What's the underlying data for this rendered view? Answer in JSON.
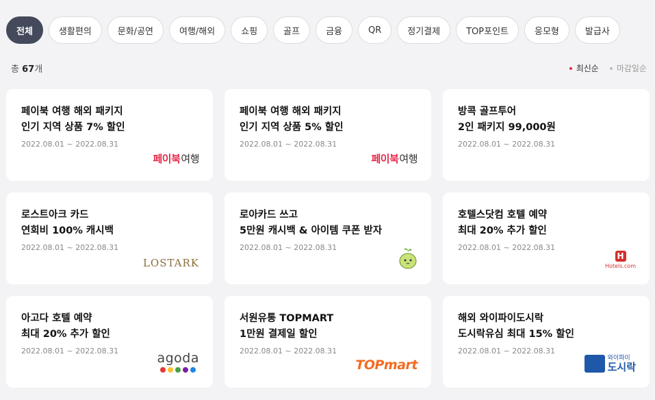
{
  "tabs": [
    {
      "label": "전체",
      "active": true
    },
    {
      "label": "생활편의"
    },
    {
      "label": "문화/공연"
    },
    {
      "label": "여행/해외"
    },
    {
      "label": "쇼핑"
    },
    {
      "label": "골프"
    },
    {
      "label": "금융"
    },
    {
      "label": "QR"
    },
    {
      "label": "정기결제"
    },
    {
      "label": "TOP포인트"
    },
    {
      "label": "응모형"
    },
    {
      "label": "발급사"
    }
  ],
  "summary": {
    "prefix": "총 ",
    "count": "67",
    "suffix": "개"
  },
  "sort": {
    "latest": "최신순",
    "deadline": "마감일순"
  },
  "cards": [
    {
      "line1": "페이북 여행 해외 패키지",
      "line2": "인기 지역 상품 7% 할인",
      "period": "2022.08.01 ~ 2022.08.31",
      "logo": {
        "main": "페이북",
        "sub": "여행"
      }
    },
    {
      "line1": "페이북 여행 해외 패키지",
      "line2": "인기 지역 상품 5% 할인",
      "period": "2022.08.01 ~ 2022.08.31",
      "logo": {
        "main": "페이북",
        "sub": "여행"
      }
    },
    {
      "line1": "방콕 골프투어",
      "line2": "2인 패키지 99,000원",
      "period": "2022.08.01 ~ 2022.08.31"
    },
    {
      "line1": "로스트아크 카드",
      "line2": "연회비 100% 캐시백",
      "period": "2022.08.01 ~ 2022.08.31",
      "logo": {
        "text": "LOSTARK"
      }
    },
    {
      "line1": "로아카드 쓰고",
      "line2": "5만원 캐시백 & 아이템 쿠폰 받자",
      "period": "2022.08.01 ~ 2022.08.31"
    },
    {
      "line1": "호텔스닷컴 호텔 예약",
      "line2": "최대 20% 추가 할인",
      "period": "2022.08.01 ~ 2022.08.31",
      "logo": {
        "mark": "H",
        "text": "Hotels.com"
      }
    },
    {
      "line1": "아고다 호텔 예약",
      "line2": "최대 20% 추가 할인",
      "period": "2022.08.01 ~ 2022.08.31",
      "logo": {
        "text": "agoda"
      }
    },
    {
      "line1": "서원유통 TOPMART",
      "line2": "1만원 결제일 할인",
      "period": "2022.08.01 ~ 2022.08.31",
      "logo": {
        "text": "TOPmart"
      }
    },
    {
      "line1": "해외 와이파이도시락",
      "line2": "도시락유심 최대 15% 할인",
      "period": "2022.08.01 ~ 2022.08.31",
      "logo": {
        "small": "와이파이",
        "big": "도시락"
      }
    }
  ],
  "colors": {
    "accent": "#e3294a",
    "active_tab": "#444a5b",
    "topmart": "#f26b21",
    "hotels": "#d32f2f",
    "dosirak": "#1f58a8"
  },
  "agoda_dots": [
    "#e53935",
    "#fbc02d",
    "#43a047",
    "#7b1fa2",
    "#1e88e5"
  ]
}
